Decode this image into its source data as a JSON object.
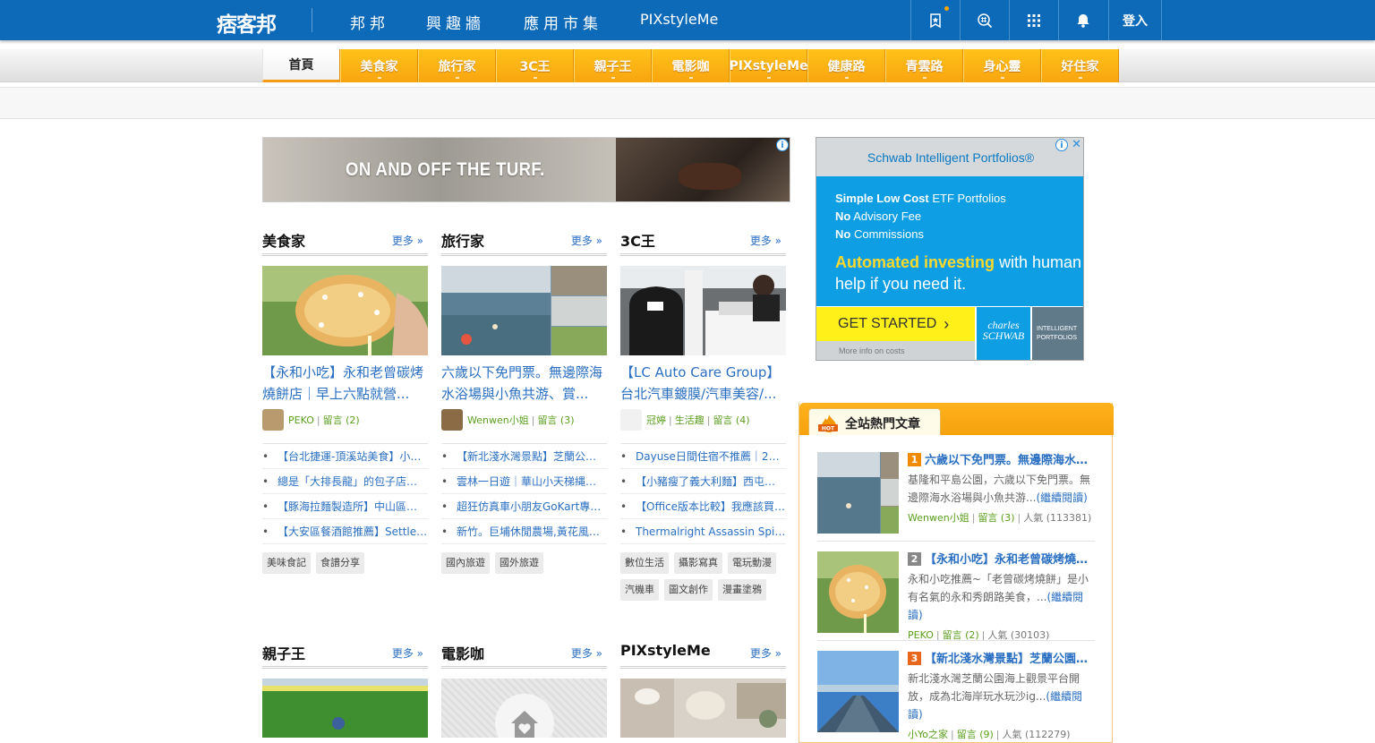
{
  "topbar": {
    "logo": "痞客邦",
    "nav": [
      "邦邦",
      "興趣牆",
      "應用市集",
      "PIXstyleMe"
    ],
    "icons": [
      "bookmark-star-icon",
      "search-hash-icon",
      "apps-grid-icon",
      "bell-icon"
    ],
    "login": "登入",
    "colors": {
      "bar": "#0c6ab9",
      "notification_dot": "#f7a600"
    }
  },
  "categories": {
    "items": [
      "首頁",
      "美食家",
      "旅行家",
      "3C王",
      "親子王",
      "電影咖",
      "PIXstyleMe",
      "健康路",
      "青雲路",
      "身心靈",
      "好住家"
    ],
    "active": "首頁",
    "colors": {
      "tab": "#f8a50f",
      "active_underline": "#f89b12"
    }
  },
  "ads": {
    "banner": {
      "text": "ON AND OFF THE TURF."
    },
    "box": {
      "header": "Schwab Intelligent Portfolios®",
      "line1_b": "Simple Low Cost",
      "line1": " ETF Portfolios",
      "line2_b": "No",
      "line2": " Advisory Fee",
      "line3_b": "No",
      "line3": " Commissions",
      "big_b": "Automated investing",
      "big": " with human help if you need it.",
      "button": "GET STARTED",
      "more": "More info on costs",
      "brand1": "charles",
      "brand2": "SCHWAB",
      "brand3": "INTELLIGENT PORTFOLIOS"
    }
  },
  "sections": [
    {
      "title": "美食家",
      "more": "更多 »",
      "headline": "【永和小吃】永和老曾碳烤燒餅店｜早上六點就營...",
      "author": "PEKO",
      "comments": "留言 (2)",
      "bullets": [
        "【台北捷運-頂溪站美食】小吃店推薦",
        "總是「大排長龍」的包子店！推薦",
        "【豚海拉麵製造所】中山區拉麵推薦",
        "【大安區餐酒館推薦】Settle Coffee"
      ],
      "tags": [
        "美味食記",
        "食譜分享"
      ]
    },
    {
      "title": "旅行家",
      "more": "更多 »",
      "headline": "六歲以下免門票。無邊際海水浴場與小魚共游、賞...",
      "author": "Wenwen小姐",
      "comments": "留言 (3)",
      "bullets": [
        "【新北淺水灣景點】芝蘭公園海上觀景",
        "雲林一日遊｜華山小天梯縄索吊橋",
        "超狂仿真車小朋友GoKart專用賽道",
        "新竹。巨埔休閒農場,黃花風鈴木"
      ],
      "tags": [
        "國內旅遊",
        "國外旅遊"
      ]
    },
    {
      "title": "3C王",
      "more": "更多 »",
      "headline": "【LC Auto Care Group】台北汽車鍍膜/汽車美容/...",
      "author": "冠婷",
      "extra": "生活趣",
      "comments": "留言 (4)",
      "bullets": [
        "Dayuse日間住宿不推薦｜2023年",
        "【小豬瘦了義大利麵】西屯聚餐推薦",
        "【Office版本比較】我應該買哪個",
        "Thermalright Assassin Spirit 120"
      ],
      "tags": [
        "數位生活",
        "攝影寫真",
        "電玩動漫",
        "汽機車",
        "圖文創作",
        "漫畫塗鴉"
      ]
    },
    {
      "title": "親子王",
      "more": "更多 »"
    },
    {
      "title": "電影咖",
      "more": "更多 »"
    },
    {
      "title": "PIXstyleMe",
      "more": "更多 »"
    }
  ],
  "hot": {
    "title": "全站熱門文章",
    "badge": "HOT",
    "items": [
      {
        "rank": "1",
        "title": "六歲以下免門票。無邊際海水浴場",
        "desc": "基隆和平島公園，六歲以下免門票。無邊際海水浴場與小魚共游...",
        "read": "(繼續閱讀)",
        "author": "Wenwen小姐",
        "comments": "留言 (3)",
        "views": "人氣 (113381)",
        "color": "#f08a00"
      },
      {
        "rank": "2",
        "title": "【永和小吃】永和老曾碳烤燒餅店",
        "desc": "永和小吃推薦~「老曾碳烤燒餅」是小有名氣的永和秀朗路美食，...",
        "read": "(繼續閱讀)",
        "author": "PEKO",
        "comments": "留言 (2)",
        "views": "人氣 (30103)",
        "color": "#888888"
      },
      {
        "rank": "3",
        "title": "【新北淺水灣景點】芝蘭公園海上",
        "desc": "新北淺水灣芝蘭公園海上觀景平台開放，成為北海岸玩水玩沙ig...",
        "read": "(繼續閱讀)",
        "author": "小Yo之家",
        "comments": "留言 (9)",
        "views": "人氣 (112279)",
        "color": "#e9661d"
      }
    ]
  }
}
